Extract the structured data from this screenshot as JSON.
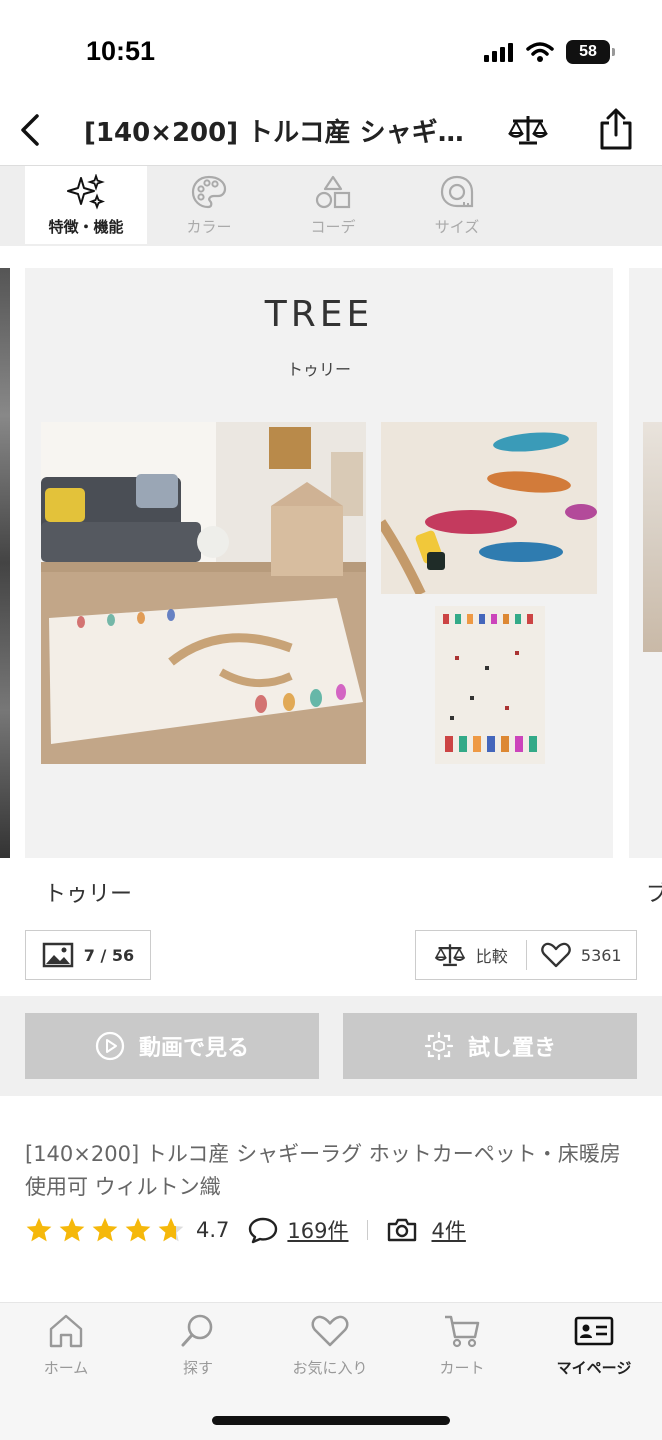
{
  "status": {
    "time": "10:51",
    "battery": "58"
  },
  "nav": {
    "title": "[140×200] トルコ産 シャギー…"
  },
  "tabs": [
    {
      "label": "特徴・機能",
      "icon": "sparkle-icon",
      "active": true
    },
    {
      "label": "カラー",
      "icon": "palette-icon",
      "active": false
    },
    {
      "label": "コーデ",
      "icon": "shapes-icon",
      "active": false
    },
    {
      "label": "サイズ",
      "icon": "tape-measure-icon",
      "active": false
    }
  ],
  "panel": {
    "title": "TREE",
    "subtitle": "トゥリー"
  },
  "caption": "トゥリー",
  "caption_next": "ブ",
  "image_counter": "7 / 56",
  "compare_label": "比較",
  "favorites_count": "5361",
  "actions": {
    "video": "動画で見る",
    "try_place": "試し置き"
  },
  "product": {
    "title": "[140×200] トルコ産 シャギーラグ ホットカーペット・床暖房使用可 ウィルトン織",
    "rating": "4.7",
    "stars": 4.7,
    "reviews": "169件",
    "photos": "4件"
  },
  "bottom_nav": [
    {
      "label": "ホーム",
      "icon": "home-icon"
    },
    {
      "label": "探す",
      "icon": "search-icon"
    },
    {
      "label": "お気に入り",
      "icon": "heart-icon"
    },
    {
      "label": "カート",
      "icon": "cart-icon"
    },
    {
      "label": "マイページ",
      "icon": "id-card-icon",
      "active": true
    }
  ],
  "colors": {
    "accent_star": "#f5b80b",
    "button_gray": "#c9c9c9",
    "panel_bg": "#f2f2f2"
  }
}
